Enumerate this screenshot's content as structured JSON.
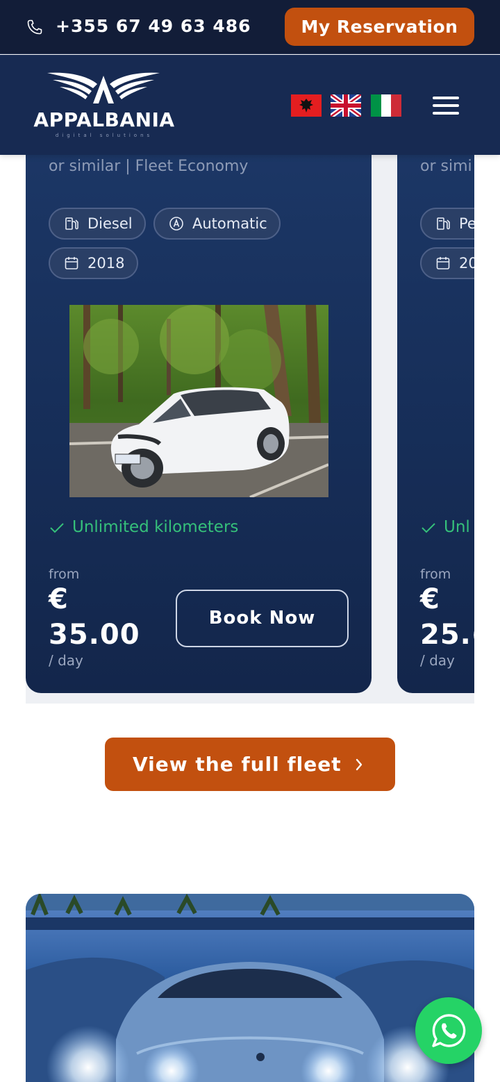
{
  "topbar": {
    "phone_icon": "phone-icon",
    "phone": "+355 67 49 63 486",
    "reservation_label": "My Reservation"
  },
  "header": {
    "logo_name": "APPALBANIA",
    "logo_tagline": "digital solutions",
    "flags": [
      "albania-flag",
      "uk-flag",
      "italy-flag"
    ],
    "menu_icon": "hamburger-menu-icon"
  },
  "cards": [
    {
      "subtitle": "or similar | Fleet Economy",
      "fuel": "Diesel",
      "transmission": "Automatic",
      "year": "2018",
      "feature": "Unlimited kilometers",
      "from_label": "from",
      "price_line1": "€",
      "price_line2": "35.00",
      "per_day": "/ day",
      "book_label": "Book Now"
    },
    {
      "subtitle": "or simi",
      "fuel": "Pe",
      "year": "20",
      "feature": "Unl",
      "from_label": "from",
      "price_line1": "€",
      "price_line2": "25.(",
      "per_day": "/ day"
    }
  ],
  "fleet_button": {
    "label": "View the full fleet",
    "icon": "chevron-right-icon"
  },
  "whatsapp": {
    "icon": "whatsapp-icon"
  },
  "colors": {
    "topbar_bg": "#121d38",
    "header_bg": "#172a52",
    "accent_orange": "#c2500f",
    "card_bg": "#172f5a",
    "feature_green": "#35c07a",
    "whatsapp_green": "#25d366"
  }
}
